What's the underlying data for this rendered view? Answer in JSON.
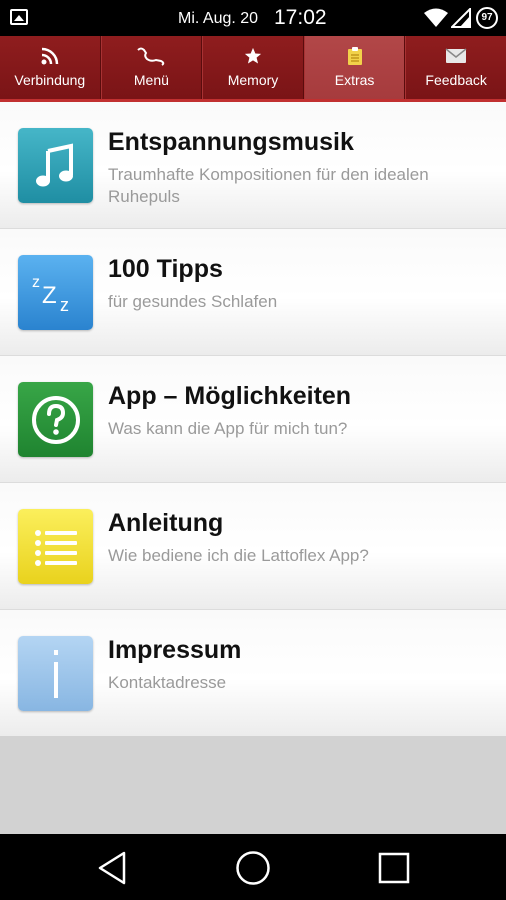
{
  "status_bar": {
    "date": "Mi. Aug. 20",
    "time": "17:02",
    "battery": "97",
    "icons": [
      "image-icon",
      "wifi-icon",
      "signal-icon",
      "battery-icon"
    ]
  },
  "tabs": [
    {
      "label": "Verbindung",
      "icon": "rss-icon",
      "active": false
    },
    {
      "label": "Menü",
      "icon": "phone-icon",
      "active": false
    },
    {
      "label": "Memory",
      "icon": "star-icon",
      "active": false
    },
    {
      "label": "Extras",
      "icon": "clipboard-icon",
      "active": true
    },
    {
      "label": "Feedback",
      "icon": "mail-icon",
      "active": false
    }
  ],
  "items": [
    {
      "title": "Entspannungsmusik",
      "subtitle": "Traumhafte Kompositionen für den idealen Ruhepuls",
      "icon": "music-note-icon",
      "color": "#2a9fb3"
    },
    {
      "title": "100 Tipps",
      "subtitle": "für gesundes Schlafen",
      "icon": "sleep-zzz-icon",
      "color": "#2f8fd8"
    },
    {
      "title": "App – Möglichkeiten",
      "subtitle": "Was kann die App für mich tun?",
      "icon": "question-icon",
      "color": "#2e9a3c"
    },
    {
      "title": "Anleitung",
      "subtitle": "Wie bediene ich die Lattoflex App?",
      "icon": "list-icon",
      "color": "#f2e030"
    },
    {
      "title": "Impressum",
      "subtitle": "Kontaktadresse",
      "icon": "info-icon",
      "color": "#9cc4ea"
    }
  ],
  "nav": [
    "back-icon",
    "home-icon",
    "recents-icon"
  ]
}
